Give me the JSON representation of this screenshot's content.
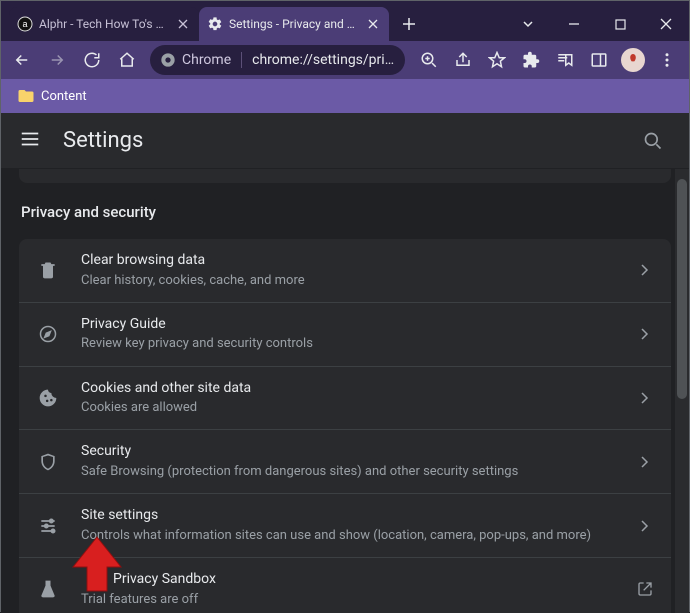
{
  "titlebar": {
    "tabs": [
      {
        "title": "Alphr - Tech How To's & G",
        "favicon": "a-circle"
      },
      {
        "title": "Settings - Privacy and sec",
        "favicon": "gear"
      }
    ]
  },
  "toolbar": {
    "omnibox_prefix": "Chrome",
    "omnibox_url": "chrome://settings/pri..."
  },
  "bookmarks": {
    "items": [
      {
        "label": "Content"
      }
    ]
  },
  "settings_header": {
    "title": "Settings"
  },
  "section": {
    "title": "Privacy and security",
    "rows": [
      {
        "icon": "trash",
        "title": "Clear browsing data",
        "sub": "Clear history, cookies, cache, and more",
        "trailing": "chevron"
      },
      {
        "icon": "compass",
        "title": "Privacy Guide",
        "sub": "Review key privacy and security controls",
        "trailing": "chevron"
      },
      {
        "icon": "cookie",
        "title": "Cookies and other site data",
        "sub": "Cookies are allowed",
        "trailing": "chevron"
      },
      {
        "icon": "shield",
        "title": "Security",
        "sub": "Safe Browsing (protection from dangerous sites) and other security settings",
        "trailing": "chevron"
      },
      {
        "icon": "sliders",
        "title": "Site settings",
        "sub": "Controls what information sites can use and show (location, camera, pop-ups, and more)",
        "trailing": "chevron"
      },
      {
        "icon": "flask",
        "title": "Privacy Sandbox",
        "sub": "Trial features are off",
        "trailing": "launch"
      }
    ]
  }
}
